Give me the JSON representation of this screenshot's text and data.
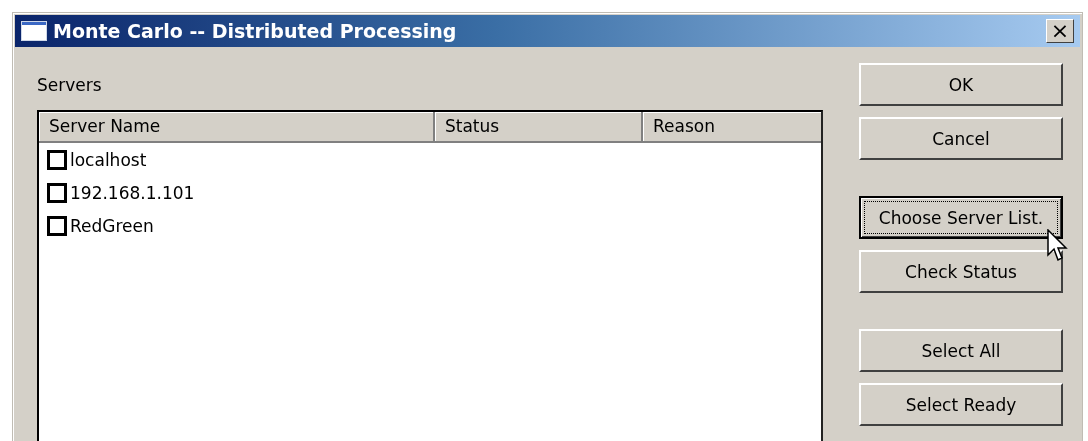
{
  "window": {
    "title": "Monte Carlo -- Distributed Processing",
    "close": "×"
  },
  "servers_label": "Servers",
  "table": {
    "columns": [
      "Server Name",
      "Status",
      "Reason"
    ],
    "rows": [
      {
        "name": "localhost",
        "checked": false
      },
      {
        "name": "192.168.1.101",
        "checked": false
      },
      {
        "name": "RedGreen",
        "checked": false
      }
    ]
  },
  "buttons": [
    {
      "label": "OK",
      "focused": false
    },
    {
      "label": "Cancel",
      "focused": false
    },
    {
      "label": "Choose Server List.",
      "focused": true
    },
    {
      "label": "Check Status",
      "focused": false
    },
    {
      "label": "Select All",
      "focused": false
    },
    {
      "label": "Select Ready",
      "focused": false
    }
  ]
}
